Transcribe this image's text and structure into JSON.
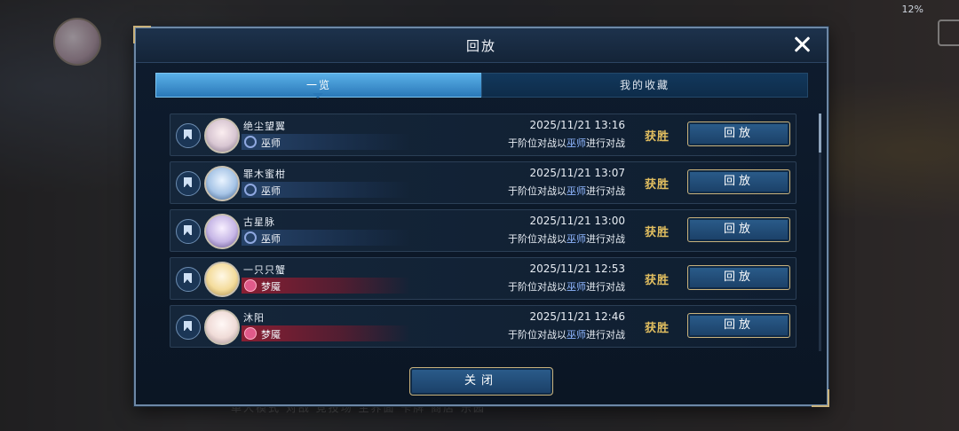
{
  "status_bar": {
    "battery": "12%"
  },
  "background": {
    "bottom_nav": "单人模式   对战   竞技场   主界面   卡牌   商店   乐园"
  },
  "dialog": {
    "title": "回放",
    "close_icon": "close-icon",
    "tabs": [
      {
        "label": "一览",
        "active": true
      },
      {
        "label": "我的收藏",
        "active": false
      }
    ],
    "records": [
      {
        "player": "绝尘望翼",
        "class_name": "巫师",
        "class_type": "wizard",
        "datetime": "2025/11/21  13:16",
        "desc_prefix": "于阶位对战以",
        "desc_class": "巫师",
        "desc_suffix": "进行对战",
        "result": "获胜",
        "replay_label": "回放"
      },
      {
        "player": "罪木蜜柑",
        "class_name": "巫师",
        "class_type": "wizard",
        "datetime": "2025/11/21  13:07",
        "desc_prefix": "于阶位对战以",
        "desc_class": "巫师",
        "desc_suffix": "进行对战",
        "result": "获胜",
        "replay_label": "回放"
      },
      {
        "player": "古星脉",
        "class_name": "巫师",
        "class_type": "wizard",
        "datetime": "2025/11/21  13:00",
        "desc_prefix": "于阶位对战以",
        "desc_class": "巫师",
        "desc_suffix": "进行对战",
        "result": "获胜",
        "replay_label": "回放"
      },
      {
        "player": "一只只蟹",
        "class_name": "梦魇",
        "class_type": "dream",
        "datetime": "2025/11/21  12:53",
        "desc_prefix": "于阶位对战以",
        "desc_class": "巫师",
        "desc_suffix": "进行对战",
        "result": "获胜",
        "replay_label": "回放"
      },
      {
        "player": "沐阳",
        "class_name": "梦魇",
        "class_type": "dream",
        "datetime": "2025/11/21  12:46",
        "desc_prefix": "于阶位对战以",
        "desc_class": "巫师",
        "desc_suffix": "进行对战",
        "result": "获胜",
        "replay_label": "回放"
      }
    ],
    "footer_button": "关闭"
  }
}
